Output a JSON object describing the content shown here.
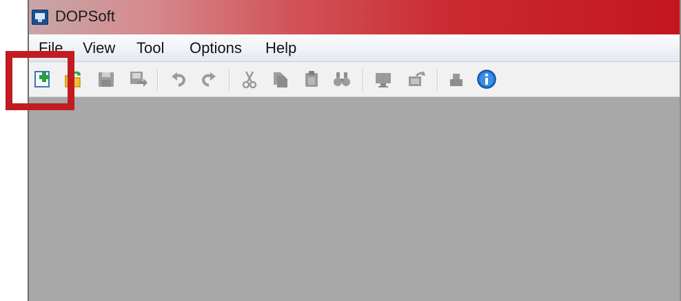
{
  "window": {
    "title": "DOPSoft"
  },
  "menu": {
    "items": [
      "File",
      "View",
      "Tool",
      "Options",
      "Help"
    ]
  },
  "toolbar": {
    "buttons": [
      {
        "name": "new-icon",
        "enabled": true
      },
      {
        "name": "open-icon",
        "enabled": true
      },
      {
        "name": "save-icon",
        "enabled": false
      },
      {
        "name": "save-as-icon",
        "enabled": false
      },
      {
        "name": "undo-icon",
        "enabled": false
      },
      {
        "name": "redo-icon",
        "enabled": false
      },
      {
        "name": "cut-icon",
        "enabled": false
      },
      {
        "name": "copy-icon",
        "enabled": false
      },
      {
        "name": "paste-icon",
        "enabled": false
      },
      {
        "name": "find-icon",
        "enabled": false
      },
      {
        "name": "compile-icon",
        "enabled": false
      },
      {
        "name": "download-icon",
        "enabled": false
      },
      {
        "name": "simulation-icon",
        "enabled": false
      },
      {
        "name": "about-icon",
        "enabled": true
      }
    ]
  },
  "colors": {
    "titlebar_accent": "#c4161e",
    "callout_border": "#c21b21",
    "workspace_bg": "#a8a8a8"
  }
}
